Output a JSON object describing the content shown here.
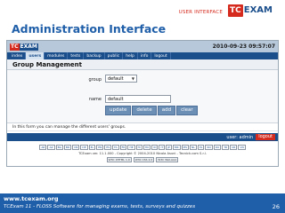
{
  "slide": {
    "header_label": "USER INTERFACE",
    "brand": {
      "tc": "TC",
      "exam": "EXAM"
    },
    "title": "Administration Interface",
    "footer": {
      "url": "www.tcexam.org",
      "caption": "TCExam 11 - FLOSS Software for managing exams, tests, surveys and quizzes",
      "page_number": "26"
    }
  },
  "app": {
    "logo": {
      "tc": "TC",
      "exam": "EXAM"
    },
    "datetime": "2010-09-23 09:57:07",
    "menu": [
      "index",
      "users",
      "modules",
      "tests",
      "backup",
      "public",
      "help",
      "info",
      "logout"
    ],
    "active_menu": "users",
    "page_title": "Group Management",
    "form": {
      "group_label": "group",
      "group_value": "default",
      "name_label": "name",
      "name_value": "default",
      "buttons": [
        "update",
        "delete",
        "add",
        "clear"
      ]
    },
    "help_text": "In this form you can manage the different users' groups.",
    "status": {
      "user_label": "user: admin",
      "logout_label": "logout"
    },
    "languages": [
      "AR",
      "AZ",
      "BG",
      "BR",
      "CN",
      "DE",
      "EL",
      "EN",
      "ES",
      "FA",
      "FR",
      "HE",
      "HI",
      "HU",
      "ID",
      "IT",
      "JP",
      "MR",
      "MS",
      "NL",
      "PL",
      "RO",
      "RU",
      "TR",
      "UR",
      "VN"
    ],
    "copyright": "TCExam ver. 11.1.000 - Copyright © 2004-2010 Nicola Asuni - Tecnick.com S.r.l.",
    "badges": [
      "W3C XHTML 1.0",
      "W3C CSS 2.0",
      "W3C WAI-AAA"
    ]
  },
  "colors": {
    "brand_blue": "#1f5ea8",
    "brand_red": "#d52b1e",
    "menu_blue": "#1b4f8c"
  }
}
